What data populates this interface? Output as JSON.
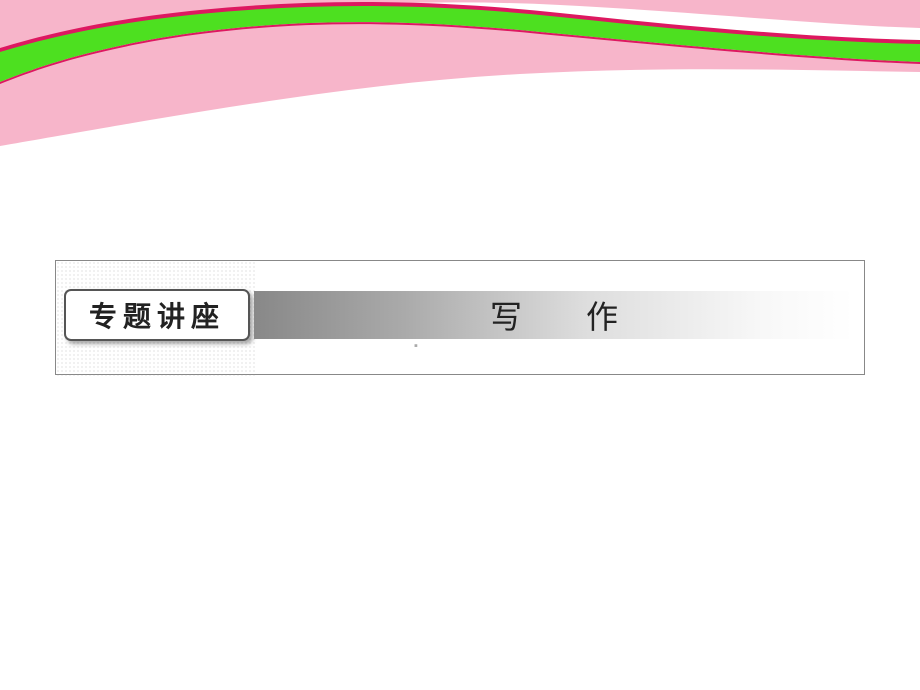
{
  "header": {
    "colors": {
      "pink": "#f7b5ca",
      "green": "#4de020",
      "magenta": "#dd1860"
    }
  },
  "content": {
    "badge_label": "专题讲座",
    "title": "写 作"
  },
  "marker": "▪"
}
